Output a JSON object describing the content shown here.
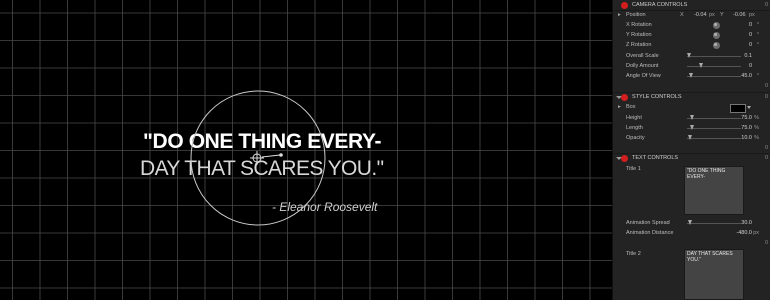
{
  "canvas": {
    "quote_line_1": "\"DO ONE THING EVERY-",
    "quote_line_2": "DAY THAT SCARES YOU.\"",
    "attribution": "- Eleanor Roosevelt"
  },
  "inspector": {
    "camera_controls": {
      "title": "CAMERA CONTROLS",
      "right_value": "0",
      "position": {
        "label": "Position",
        "x_label": "X",
        "x_value": "-0.04",
        "x_unit": "px",
        "y_label": "Y",
        "y_value": "-0.06",
        "y_unit": "px"
      },
      "x_rotation": {
        "label": "X Rotation",
        "value": "0",
        "unit": "°"
      },
      "y_rotation": {
        "label": "Y Rotation",
        "value": "0",
        "unit": "°"
      },
      "z_rotation": {
        "label": "Z Rotation",
        "value": "0",
        "unit": "°"
      },
      "overall_scale": {
        "label": "Overall Scale",
        "value": "0.1"
      },
      "dolly_amount": {
        "label": "Dolly Amount",
        "value": "0"
      },
      "angle_of_view": {
        "label": "Angle Of View",
        "value": "45.0",
        "unit": "°"
      },
      "trailing_value": "0"
    },
    "style_controls": {
      "title": "STYLE CONTROLS",
      "right_value": "0",
      "box": {
        "label": "Box",
        "swatch_color": "#000000"
      },
      "height": {
        "label": "Height",
        "value": "75.0",
        "unit": "%"
      },
      "length": {
        "label": "Length",
        "value": "75.0",
        "unit": "%"
      },
      "opacity": {
        "label": "Opacity",
        "value": "10.0",
        "unit": "%"
      },
      "trailing_value": "0"
    },
    "text_controls": {
      "title": "TEXT CONTROLS",
      "right_value": "0",
      "title_1": {
        "label": "Title 1",
        "text": "\"DO ONE THING EVERY-"
      },
      "animation_spread": {
        "label": "Animation Spread",
        "value": "30.0"
      },
      "animation_distance": {
        "label": "Animation Distance",
        "value": "-480.0",
        "unit": "px"
      },
      "trailing_value": "0",
      "title_2": {
        "label": "Title 2",
        "text": "DAY THAT SCARES\nYOU.\""
      }
    }
  }
}
